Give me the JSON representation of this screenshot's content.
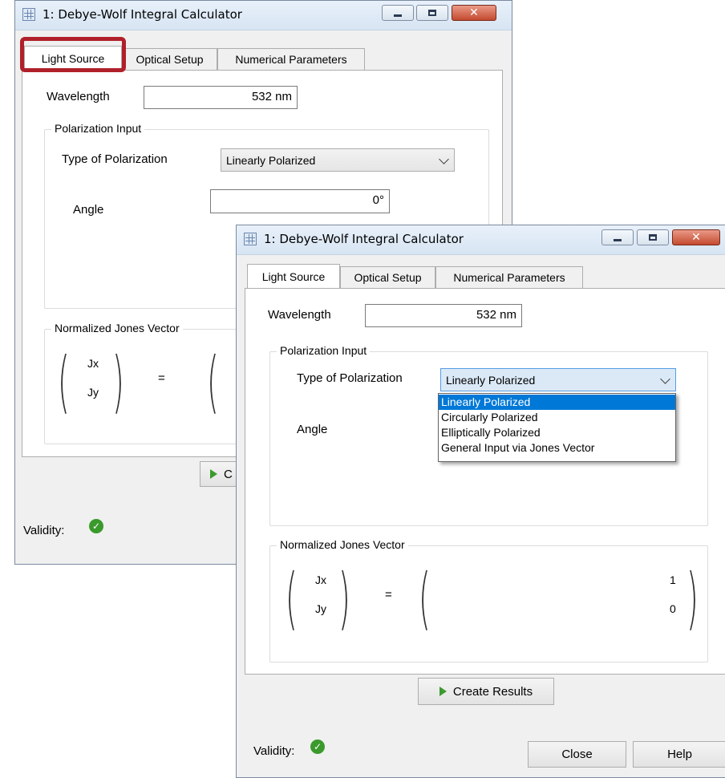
{
  "back_window": {
    "title": "1: Debye-Wolf Integral Calculator",
    "tabs": [
      "Light Source",
      "Optical Setup",
      "Numerical Parameters"
    ],
    "wavelength_label": "Wavelength",
    "wavelength_value": "532 nm",
    "polarization_group": "Polarization Input",
    "polarization_type_label": "Type of Polarization",
    "polarization_type_value": "Linearly Polarized",
    "angle_label": "Angle",
    "angle_value": "0°",
    "jones_group": "Normalized Jones Vector",
    "jx": "Jx",
    "jy": "Jy",
    "equals": "=",
    "create_button_partial": "C",
    "validity_label": "Validity:"
  },
  "front_window": {
    "title": "1: Debye-Wolf Integral Calculator",
    "tabs": [
      "Light Source",
      "Optical Setup",
      "Numerical Parameters"
    ],
    "wavelength_label": "Wavelength",
    "wavelength_value": "532 nm",
    "polarization_group": "Polarization Input",
    "polarization_type_label": "Type of Polarization",
    "polarization_type_value": "Linearly Polarized",
    "polarization_options": [
      "Linearly Polarized",
      "Circularly Polarized",
      "Elliptically Polarized",
      "General Input via Jones Vector"
    ],
    "angle_label": "Angle",
    "jones_group": "Normalized Jones Vector",
    "jx": "Jx",
    "jy": "Jy",
    "equals": "=",
    "jx_value": "1",
    "jy_value": "0",
    "create_button": "Create Results",
    "validity_label": "Validity:",
    "close_button": "Close",
    "help_button": "Help"
  },
  "colors": {
    "highlight": "#b0202a",
    "selection": "#0078d7",
    "valid_check": "#3a9a2c"
  },
  "icons": {
    "app": "calculator-icon",
    "validity": "check-circle-icon",
    "create": "play-icon"
  }
}
